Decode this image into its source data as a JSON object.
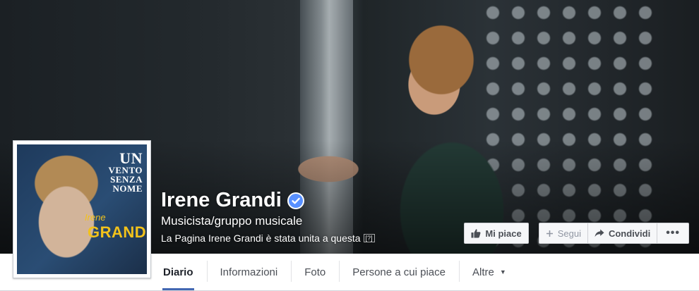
{
  "profile": {
    "name": "Irene Grandi",
    "category": "Musicista/gruppo musicale",
    "merge_notice": "La Pagina Irene Grandi è stata unita a questa",
    "help_marker": "[?]",
    "verified_icon": "verified-badge-icon"
  },
  "album_cover": {
    "title_line1": "UN",
    "title_line2": "VENTO",
    "title_line3": "SENZA",
    "title_line4": "NOME",
    "artist_small": "Irene",
    "artist_big": "GRANDI"
  },
  "actions": {
    "like_label": "Mi piace",
    "follow_label": "Segui",
    "share_label": "Condividi",
    "more_label": "•••"
  },
  "tabs": [
    {
      "label": "Diario",
      "active": true
    },
    {
      "label": "Informazioni"
    },
    {
      "label": "Foto"
    },
    {
      "label": "Persone a cui piace"
    },
    {
      "label": "Altre"
    }
  ],
  "colors": {
    "accent": "#4267b2",
    "verified": "#5890ff",
    "album_text": "#f2c21b"
  }
}
